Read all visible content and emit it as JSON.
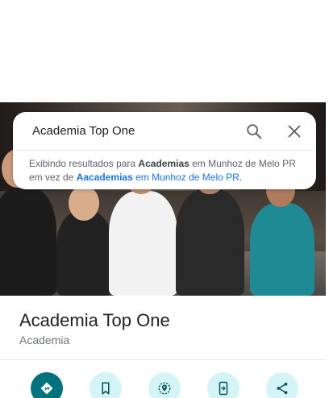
{
  "search": {
    "query": "Academia Top One",
    "hint_prefix": "Exibindo resultados para ",
    "hint_term": "Academias",
    "hint_mid": " em Munhoz de Melo PR em vez de ",
    "alt_term": "Aacademias",
    "alt_rest": " em Munhoz de Melo PR",
    "hint_end": "."
  },
  "place": {
    "title": "Academia Top One",
    "category": "Academia"
  },
  "actions": [
    {
      "icon": "directions-icon"
    },
    {
      "icon": "bookmark-icon"
    },
    {
      "icon": "nearby-icon"
    },
    {
      "icon": "send-to-phone-icon"
    },
    {
      "icon": "share-icon"
    }
  ],
  "colors": {
    "accent": "#00727e",
    "action_bg": "#d4f4f8",
    "link": "#1a73e8"
  }
}
